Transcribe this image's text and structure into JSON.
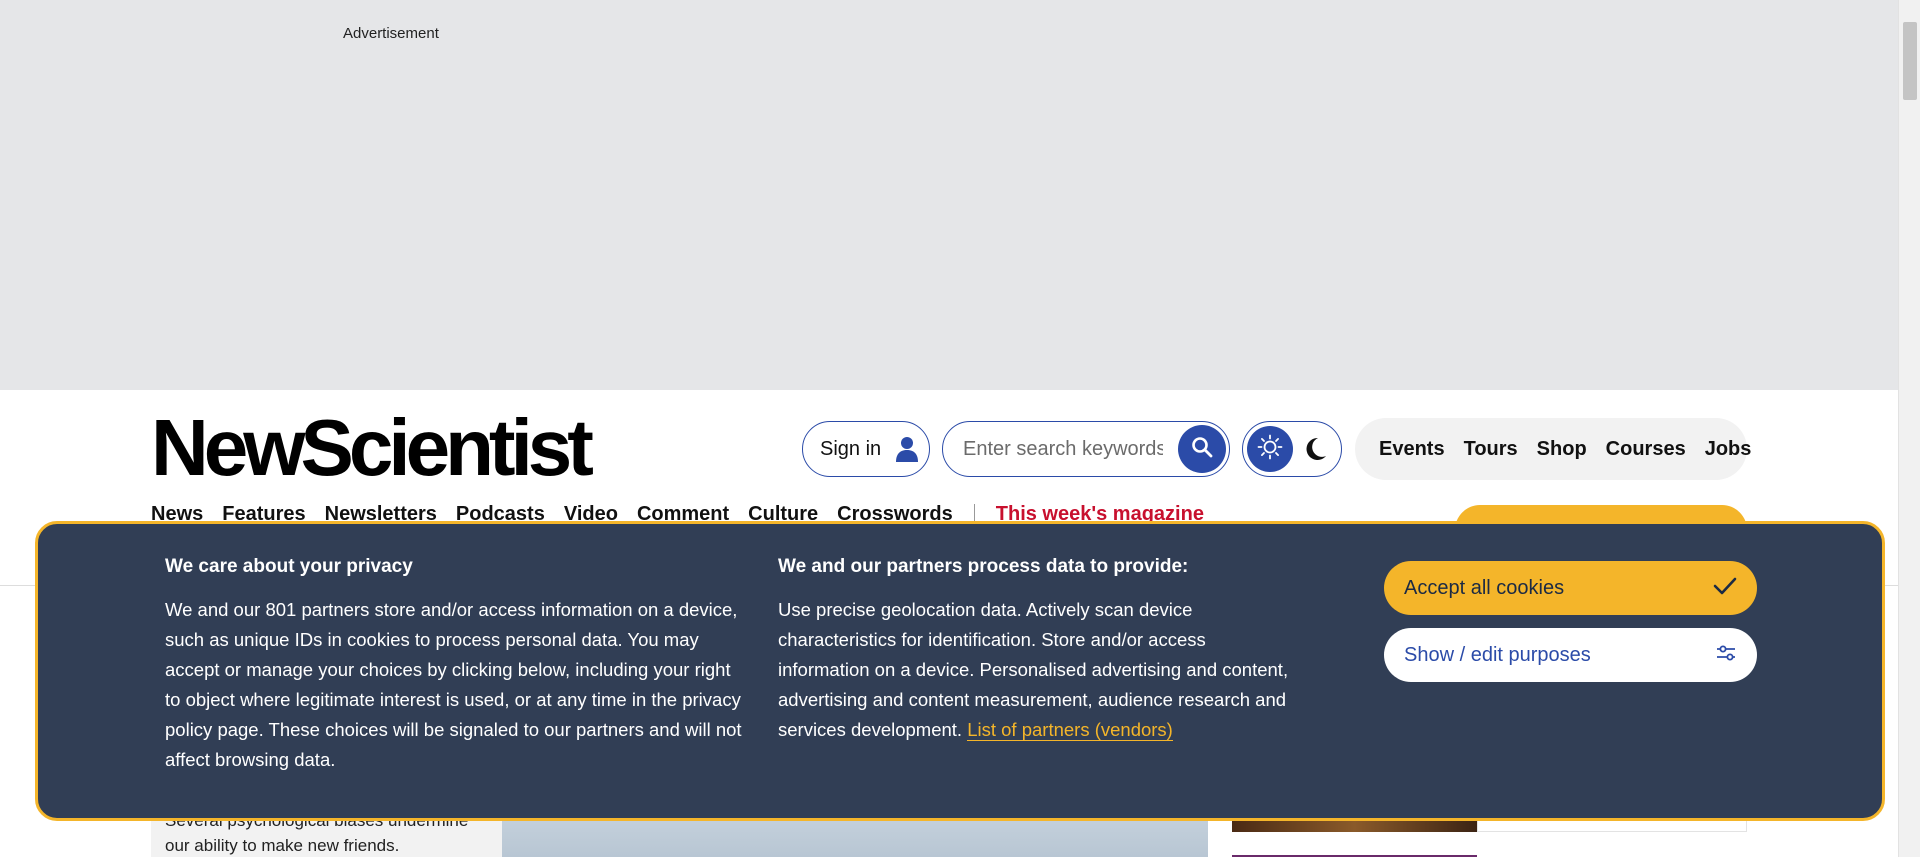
{
  "ad": {
    "label": "Advertisement"
  },
  "header": {
    "logo_text": "NewScientist",
    "signin_label": "Sign in",
    "search": {
      "placeholder": "Enter search keywords"
    },
    "top_links": [
      "Events",
      "Tours",
      "Shop",
      "Courses",
      "Jobs"
    ],
    "nav": [
      "News",
      "Features",
      "Newsletters",
      "Podcasts",
      "Video",
      "Comment",
      "Culture",
      "Crosswords"
    ],
    "magazine_link": "This week's magazine"
  },
  "content": {
    "teaser_text": "Several psychological biases undermine our ability to make new friends."
  },
  "privacy": {
    "col1_title": "We care about your privacy",
    "col1_text": "We and our 801 partners store and/or access information on a device, such as unique IDs in cookies to process personal data. You may accept or manage your choices by clicking below, including your right to object where legitimate interest is used, or at any time in the privacy policy page. These choices will be signaled to our partners and will not affect browsing data.",
    "col2_title": "We and our partners process data to provide:",
    "col2_text": "Use precise geolocation data. Actively scan device characteristics for identification. Store and/or access information on a device. Personalised advertising and content, advertising and content measurement, audience research and services development.",
    "partners_link": "List of partners (vendors)",
    "accept_label": "Accept all cookies",
    "edit_label": "Show / edit purposes"
  },
  "colors": {
    "accent_blue": "#2b4ba8",
    "accent_yellow": "#f4b52a",
    "banner_bg": "#313e55",
    "magazine_red": "#c8102e"
  }
}
